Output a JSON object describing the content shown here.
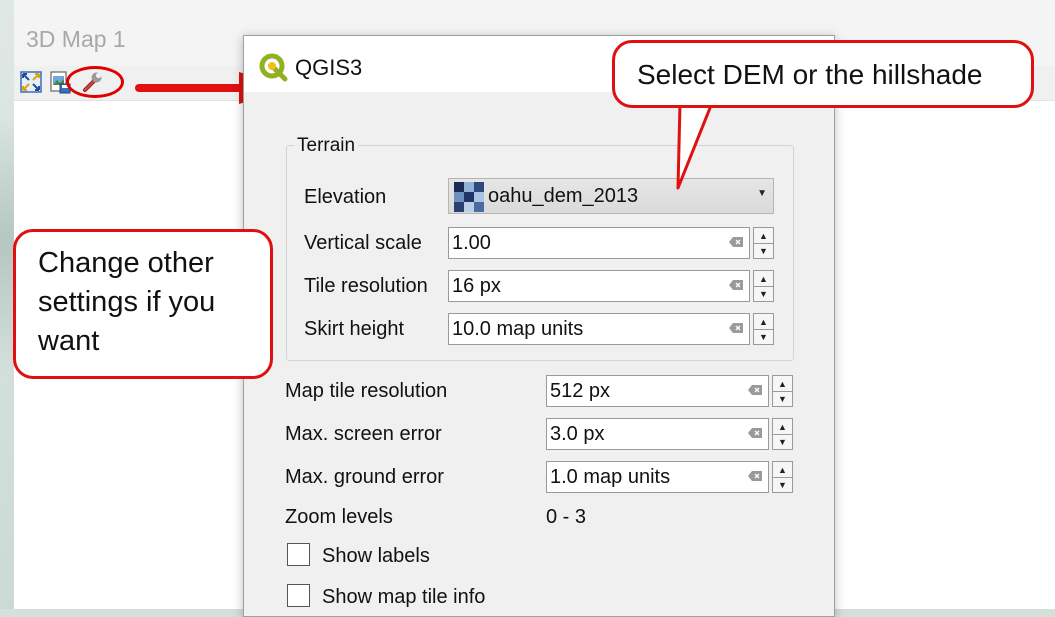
{
  "window3d": {
    "title": "3D Map 1",
    "toolbar": [
      {
        "icon": "zoom-full-icon"
      },
      {
        "icon": "save-image-icon"
      },
      {
        "icon": "configure-wrench-icon"
      }
    ]
  },
  "dialog": {
    "title": "QGIS3",
    "terrain_group": "Terrain",
    "elevation": {
      "label": "Elevation",
      "value": "oahu_dem_2013"
    },
    "vertical_scale": {
      "label": "Vertical scale",
      "value": "1.00"
    },
    "tile_resolution": {
      "label": "Tile resolution",
      "value": "16 px"
    },
    "skirt_height": {
      "label": "Skirt height",
      "value": "10.0 map units"
    },
    "map_tile_resolution": {
      "label": "Map tile resolution",
      "value": "512 px"
    },
    "max_screen_error": {
      "label": "Max. screen error",
      "value": "3.0 px"
    },
    "max_ground_error": {
      "label": "Max. ground error",
      "value": "1.0 map units"
    },
    "zoom_levels": {
      "label": "Zoom levels",
      "value": "0 - 3"
    },
    "show_labels": {
      "label": "Show labels",
      "checked": false
    },
    "show_tile_info": {
      "label": "Show map tile info",
      "checked": false
    }
  },
  "callouts": {
    "dem": "Select DEM or the hillshade",
    "settings_line1": "Change other",
    "settings_line2": "settings if you",
    "settings_line3": "want"
  },
  "colors": {
    "annotation_red": "#e01010",
    "qgis_green": "#93b023",
    "qgis_yellow": "#f0c018"
  }
}
